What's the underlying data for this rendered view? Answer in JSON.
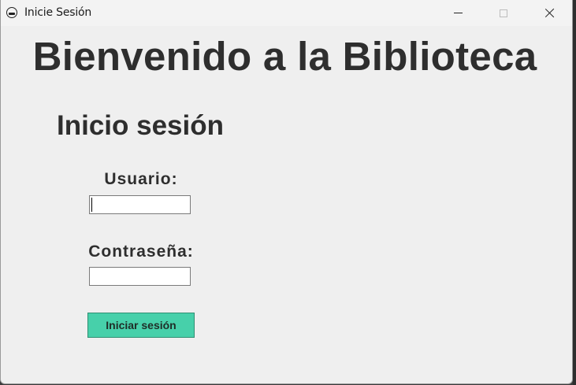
{
  "window": {
    "title": "Inicie Sesión",
    "icon": "app-icon"
  },
  "titlebar_buttons": {
    "minimize_icon": "minimize-icon",
    "maximize_icon": "maximize-icon",
    "close_icon": "close-icon"
  },
  "main": {
    "welcome_title": "Bienvenido a la Biblioteca",
    "login_heading": "Inicio sesión",
    "username_label": "Usuario:",
    "username_value": "",
    "password_label": "Contraseña:",
    "password_value": "",
    "login_button": "Iniciar sesión"
  },
  "colors": {
    "button_bg": "#47d0aa",
    "window_bg": "#efefef",
    "text": "#2e2e2e"
  }
}
